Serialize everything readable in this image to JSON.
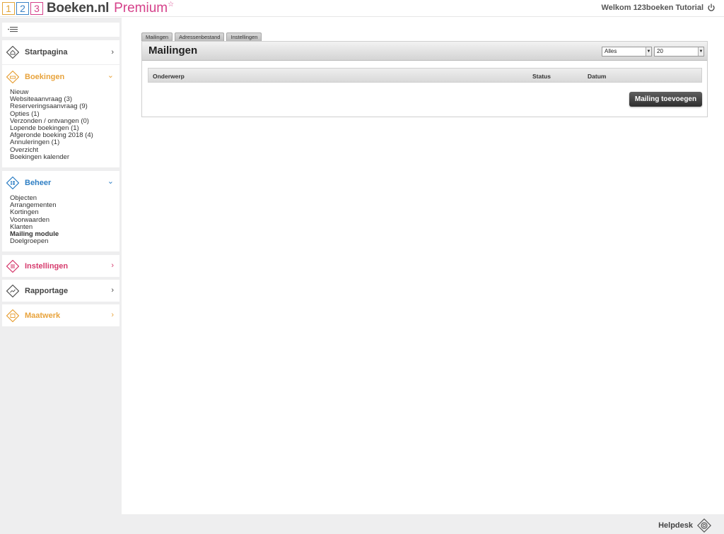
{
  "header": {
    "logo_digits": [
      "1",
      "2",
      "3"
    ],
    "logo_text": "Boeken.nl",
    "logo_premium": "Premium",
    "logo_star": "☆",
    "welcome": "Welkom 123boeken Tutorial"
  },
  "sidebar": {
    "startpagina": {
      "title": "Startpagina",
      "chevron": "›"
    },
    "boekingen": {
      "title": "Boekingen",
      "chevron": "⌄",
      "items": [
        "Nieuw",
        "Websiteaanvraag (3)",
        "Reserveringsaanvraag (9)",
        "Opties (1)",
        "Verzonden / ontvangen (0)",
        "Lopende boekingen (1)",
        "Afgeronde boeking 2018 (4)",
        "Annuleringen (1)",
        "Overzicht",
        "Boekingen kalender"
      ]
    },
    "beheer": {
      "title": "Beheer",
      "chevron": "⌄",
      "items": [
        "Objecten",
        "Arrangementen",
        "Kortingen",
        "Voorwaarden",
        "Klanten",
        "Mailing module",
        "Doelgroepen"
      ]
    },
    "instellingen": {
      "title": "Instellingen",
      "chevron": "›"
    },
    "rapportage": {
      "title": "Rapportage",
      "chevron": "›"
    },
    "maatwerk": {
      "title": "Maatwerk",
      "chevron": "›"
    }
  },
  "tabs": [
    "Mailingen",
    "Adressenbestand",
    "Instellingen"
  ],
  "panel": {
    "title": "Mailingen",
    "filter_value": "Alles",
    "count_value": "20",
    "columns": [
      "Onderwerp",
      "Status",
      "Datum"
    ],
    "add_button": "Mailing toevoegen"
  },
  "footer": {
    "helpdesk": "Helpdesk"
  },
  "colors": {
    "logo_1": "#e3a63a",
    "logo_2": "#3c83c7",
    "logo_3": "#d5418a",
    "boekingen": "#e8a33c",
    "beheer": "#2f7fc4",
    "instellingen": "#d63b6d",
    "rapportage": "#555555",
    "maatwerk": "#e8a33c",
    "startpagina": "#555555"
  }
}
